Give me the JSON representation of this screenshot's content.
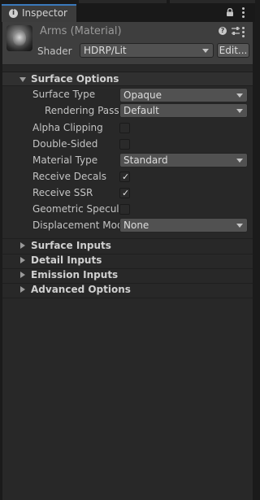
{
  "tab": {
    "title": "Inspector"
  },
  "header": {
    "material_name": "Arms (Material)",
    "shader_label": "Shader",
    "shader_value": "HDRP/Lit",
    "edit_button": "Edit..."
  },
  "surface_options": {
    "title": "Surface Options",
    "expanded": true,
    "properties": [
      {
        "label": "Surface Type",
        "type": "dropdown",
        "value": "Opaque"
      },
      {
        "label": "Rendering Pass",
        "type": "dropdown",
        "value": "Default",
        "indented": true
      },
      {
        "label": "Alpha Clipping",
        "type": "checkbox",
        "checked": false
      },
      {
        "label": "Double-Sided",
        "type": "checkbox",
        "checked": false
      },
      {
        "label": "Material Type",
        "type": "dropdown",
        "value": "Standard"
      },
      {
        "label": "Receive Decals",
        "type": "checkbox",
        "checked": true
      },
      {
        "label": "Receive SSR",
        "type": "checkbox",
        "checked": true
      },
      {
        "label": "Geometric Specula",
        "type": "checkbox",
        "checked": false
      },
      {
        "label": "Displacement Mod",
        "type": "dropdown",
        "value": "None"
      }
    ]
  },
  "collapsed_sections": [
    {
      "title": "Surface Inputs"
    },
    {
      "title": "Detail Inputs"
    },
    {
      "title": "Emission Inputs"
    },
    {
      "title": "Advanced Options"
    }
  ],
  "icons": {
    "tab": "info-icon",
    "lock": "lock-icon",
    "menu": "kebab-menu-icon",
    "help": "help-icon",
    "presets": "presets-sliders-icon",
    "check": "✓"
  },
  "colors": {
    "accent": "#3a79bb",
    "panel_bg": "#282828",
    "header_bg": "#3e3e3e",
    "field_bg": "#515151"
  }
}
